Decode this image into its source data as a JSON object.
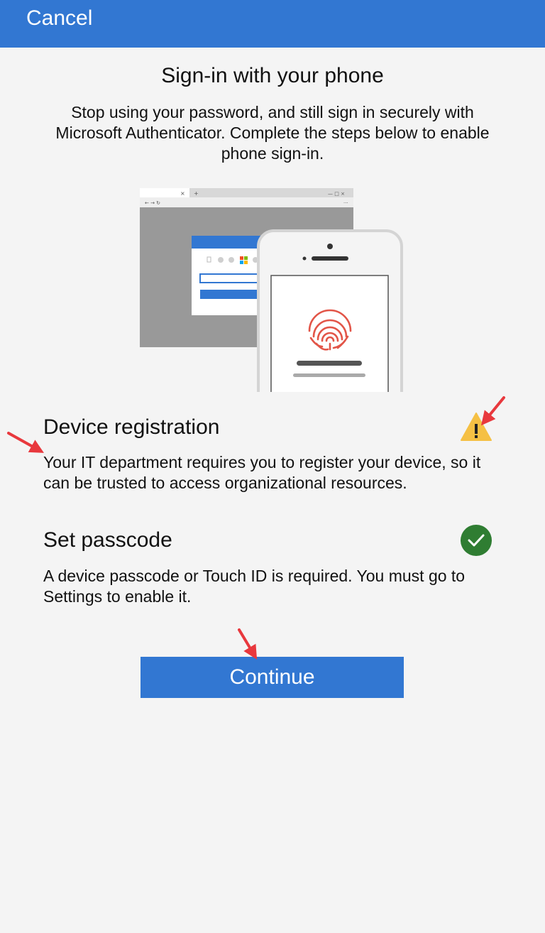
{
  "header": {
    "cancel_label": "Cancel",
    "color": "#3277d2"
  },
  "main": {
    "title": "Sign-in with your phone",
    "subtitle": "Stop using your password, and still sign in securely with Microsoft Authenticator. Complete the steps below to enable phone sign-in."
  },
  "illustration": {
    "icon": "browser-and-phone-fingerprint-illustration"
  },
  "steps": [
    {
      "title": "Device registration",
      "description": "Your IT department requires you to register your device, so it can be trusted to access organizational resources.",
      "status_icon": "warning-icon",
      "status_color": "#f5c044"
    },
    {
      "title": "Set passcode",
      "description": "A device passcode or Touch ID is required. You must go to Settings to enable it.",
      "status_icon": "check-circle-icon",
      "status_color": "#2f7d32"
    }
  ],
  "actions": {
    "continue_label": "Continue"
  },
  "annotation_color": "#e8383d"
}
